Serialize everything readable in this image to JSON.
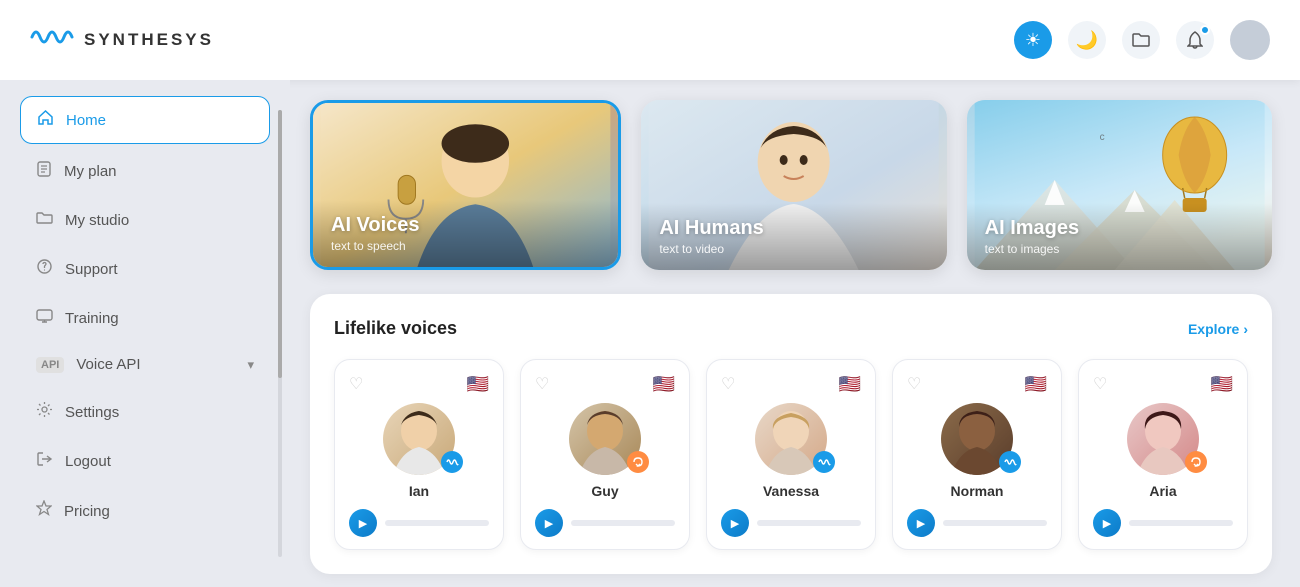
{
  "app": {
    "name": "SYNTHESYS",
    "logo_unicode": "〰"
  },
  "header": {
    "light_mode_label": "☀",
    "dark_mode_label": "🌙",
    "folder_label": "📁",
    "bell_label": "🔔"
  },
  "sidebar": {
    "items": [
      {
        "id": "home",
        "label": "Home",
        "icon": "⌂",
        "active": true
      },
      {
        "id": "my-plan",
        "label": "My plan",
        "icon": "📄"
      },
      {
        "id": "my-studio",
        "label": "My studio",
        "icon": "📁"
      },
      {
        "id": "support",
        "label": "Support",
        "icon": "❓"
      },
      {
        "id": "training",
        "label": "Training",
        "icon": "🖥"
      },
      {
        "id": "voice-api",
        "label": "Voice API",
        "icon": "API",
        "hasArrow": true
      },
      {
        "id": "settings",
        "label": "Settings",
        "icon": "⚙"
      },
      {
        "id": "logout",
        "label": "Logout",
        "icon": "↪"
      },
      {
        "id": "pricing",
        "label": "Pricing",
        "icon": "◇"
      }
    ]
  },
  "categories": [
    {
      "id": "ai-voices",
      "title": "AI Voices",
      "subtitle": "text to speech",
      "selected": true
    },
    {
      "id": "ai-humans",
      "title": "AI Humans",
      "subtitle": "text to video",
      "selected": false
    },
    {
      "id": "ai-images",
      "title": "AI Images",
      "subtitle": "text to images",
      "selected": false
    }
  ],
  "voices_section": {
    "title": "Lifelike voices",
    "explore_label": "Explore",
    "explore_arrow": "›",
    "voices": [
      {
        "id": "ian",
        "name": "Ian",
        "flag": "🇺🇸",
        "badge_type": "wave",
        "badge_color": "blue"
      },
      {
        "id": "guy",
        "name": "Guy",
        "flag": "🇺🇸",
        "badge_type": "loop",
        "badge_color": "orange"
      },
      {
        "id": "vanessa",
        "name": "Vanessa",
        "flag": "🇺🇸",
        "badge_type": "wave",
        "badge_color": "blue"
      },
      {
        "id": "norman",
        "name": "Norman",
        "flag": "🇺🇸",
        "badge_type": "wave",
        "badge_color": "blue"
      },
      {
        "id": "aria",
        "name": "Aria",
        "flag": "🇺🇸",
        "badge_type": "loop",
        "badge_color": "orange"
      }
    ]
  },
  "colors": {
    "accent": "#1a9be8",
    "orange": "#ff8c42"
  }
}
